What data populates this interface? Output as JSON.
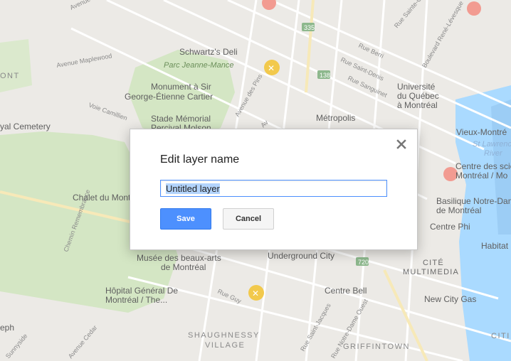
{
  "dialog": {
    "title": "Edit layer name",
    "input_value": "Untitled layer",
    "save_label": "Save",
    "cancel_label": "Cancel",
    "close_icon": "close-icon"
  },
  "map": {
    "labels": {
      "schwartz": "Schwartz's Deli",
      "parc": "Parc Jeanne-Mance",
      "monument1": "Monument à Sir",
      "monument2": "George-Étienne Cartier",
      "stade1": "Stade Mémorial",
      "stade2": "Percival Molson",
      "cemetery": "yal Cemetery",
      "chalet": "Chalet du Mont",
      "metropolis": "Métropolis",
      "uqam1": "Université",
      "uqam2": "du Québec",
      "uqam3": "à Montréal",
      "vieux": "Vieux-Montré",
      "stlaurent1": "St Lawrenc",
      "stlaurent2": "River",
      "centresci1": "Centre des scie",
      "centresci2": "Montréal / Mo",
      "basilique1": "Basilique Notre-Dame",
      "basilique2": "de Montréal",
      "centrephi": "Centre Phi",
      "habitat": "Habitat",
      "undergroundcity": "Underground City",
      "musee1": "Musée des beaux-arts",
      "musee2": "de Montréal",
      "cite1": "CITÉ",
      "cite2": "MULTIMEDIA",
      "centrebell": "Centre Bell",
      "newcitygas": "New City Gas",
      "hopital1": "Hôpital Général De",
      "hopital2": "Montréal / The...",
      "shaughnessy1": "SHAUGHNESSY",
      "shaughnessy2": "VILLAGE",
      "griffintown": "GRIFFINTOWN",
      "ont": "ONT",
      "eph": "eph",
      "citi": "CITI",
      "avmaplewood": "Avenue Maplewood",
      "avparc": "Avenue du Parc",
      "avdespins": "Avenue des Pins",
      "ruesaintedenis": "Rue Saint-Denis",
      "rueberri": "Rue Berri",
      "ruesanguinet": "Rue Sanguinet",
      "rueguy": "Rue Guy",
      "ruestmcatherine": "Rue Sainte-Cathe",
      "boulrenelevesque": "Boulevard René-Lévesque",
      "chemincamillien": "Voie Camillien",
      "cheminremembrance": "Chemin Remembrance",
      "ruestjacques": "Rue Saint-Jacques",
      "ruenotredame": "Rue Notre-Dame Ouest",
      "avcedar": "Avenue Cedar",
      "sunnyside": "Sunnyside",
      "route335": "335",
      "route138": "138",
      "route720": "720",
      "av": "Av"
    }
  }
}
